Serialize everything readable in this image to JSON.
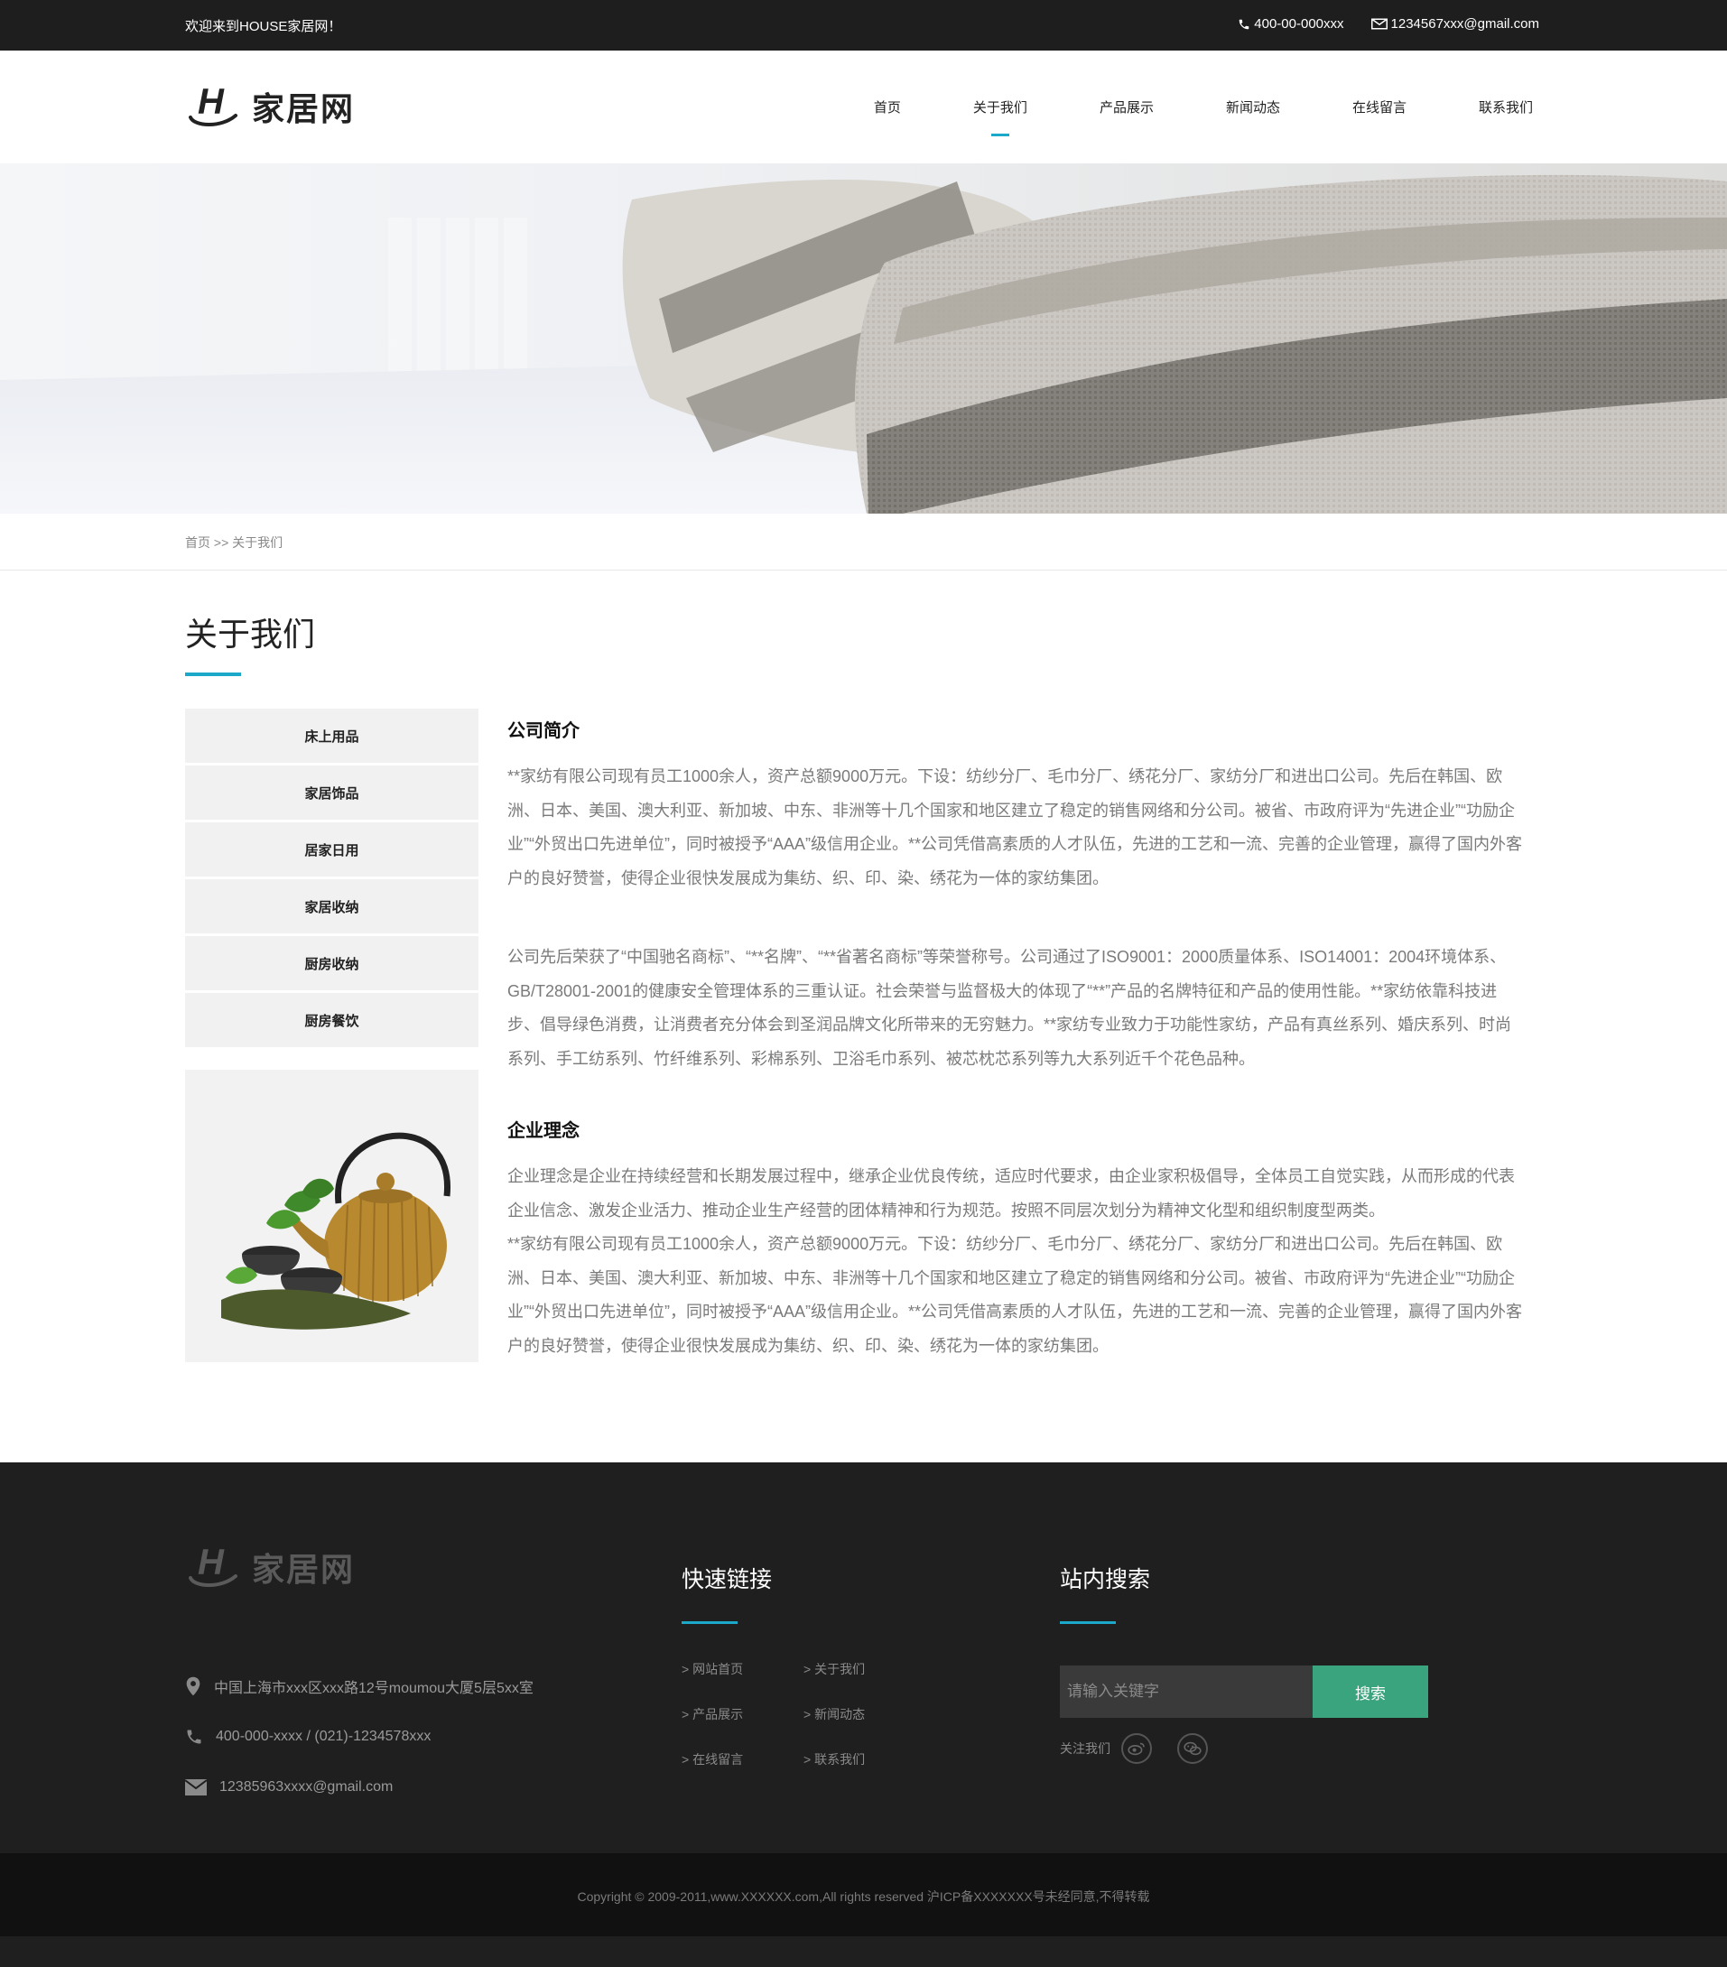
{
  "topbar": {
    "welcome": "欢迎来到HOUSE家居网！",
    "phone": "400-00-000xxx",
    "email": "1234567xxx@gmail.com"
  },
  "header": {
    "logo_text": "家居网",
    "nav": [
      "首页",
      "关于我们",
      "产品展示",
      "新闻动态",
      "在线留言",
      "联系我们"
    ],
    "active_nav": "关于我们"
  },
  "breadcrumb": "首页 >> 关于我们",
  "page_title": "关于我们",
  "sidebar": {
    "items": [
      "床上用品",
      "家居饰品",
      "居家日用",
      "家居收纳",
      "厨房收纳",
      "厨房餐饮"
    ]
  },
  "content": {
    "section1_title": "公司简介",
    "section1_p1": "**家纺有限公司现有员工1000余人，资产总额9000万元。下设：纺纱分厂、毛巾分厂、绣花分厂、家纺分厂和进出口公司。先后在韩国、欧洲、日本、美国、澳大利亚、新加坡、中东、非洲等十几个国家和地区建立了稳定的销售网络和分公司。被省、市政府评为“先进企业”“功励企业”“外贸出口先进单位”，同时被授予“AAA”级信用企业。**公司凭借高素质的人才队伍，先进的工艺和一流、完善的企业管理，赢得了国内外客户的良好赞誉，使得企业很快发展成为集纺、织、印、染、绣花为一体的家纺集团。",
    "section1_p2": "公司先后荣获了“中国驰名商标”、“**名牌”、“**省著名商标”等荣誉称号。公司通过了ISO9001：2000质量体系、ISO14001：2004环境体系、GB/T28001-2001的健康安全管理体系的三重认证。社会荣誉与监督极大的体现了“**”产品的名牌特征和产品的使用性能。**家纺依靠科技进步、倡导绿色消费，让消费者充分体会到圣润品牌文化所带来的无穷魅力。**家纺专业致力于功能性家纺，产品有真丝系列、婚庆系列、时尚系列、手工纺系列、竹纤维系列、彩棉系列、卫浴毛巾系列、被芯枕芯系列等九大系列近千个花色品种。",
    "section2_title": "企业理念",
    "section2_p1": "企业理念是企业在持续经营和长期发展过程中，继承企业优良传统，适应时代要求，由企业家积极倡导，全体员工自觉实践，从而形成的代表企业信念、激发企业活力、推动企业生产经营的团体精神和行为规范。按照不同层次划分为精神文化型和组织制度型两类。",
    "section2_p2": "**家纺有限公司现有员工1000余人，资产总额9000万元。下设：纺纱分厂、毛巾分厂、绣花分厂、家纺分厂和进出口公司。先后在韩国、欧洲、日本、美国、澳大利亚、新加坡、中东、非洲等十几个国家和地区建立了稳定的销售网络和分公司。被省、市政府评为“先进企业”“功励企业”“外贸出口先进单位”，同时被授予“AAA”级信用企业。**公司凭借高素质的人才队伍，先进的工艺和一流、完善的企业管理，赢得了国内外客户的良好赞誉，使得企业很快发展成为集纺、织、印、染、绣花为一体的家纺集团。"
  },
  "footer": {
    "logo_text": "家居网",
    "address": "中国上海市xxx区xxx路12号moumou大厦5层5xx室",
    "phone": "400-000-xxxx / (021)-1234578xxx",
    "email": "12385963xxxx@gmail.com",
    "links_title": "快速链接",
    "links": [
      "> 网站首页",
      "> 关于我们",
      "> 产品展示",
      "> 新闻动态",
      "> 在线留言",
      "> 联系我们"
    ],
    "search_title": "站内搜索",
    "search_placeholder": "请输入关键字",
    "search_button": "搜索",
    "follow_label": "关注我们"
  },
  "copyright": "Copyright © 2009-2011,www.XXXXXX.com,All rights reserved 沪ICP备XXXXXXX号未经同意,不得转载",
  "colors": {
    "accent": "#1ca8c8",
    "search_button": "#3aa47e",
    "topbar": "#1e1e1e",
    "footer": "#1f1f1f"
  }
}
